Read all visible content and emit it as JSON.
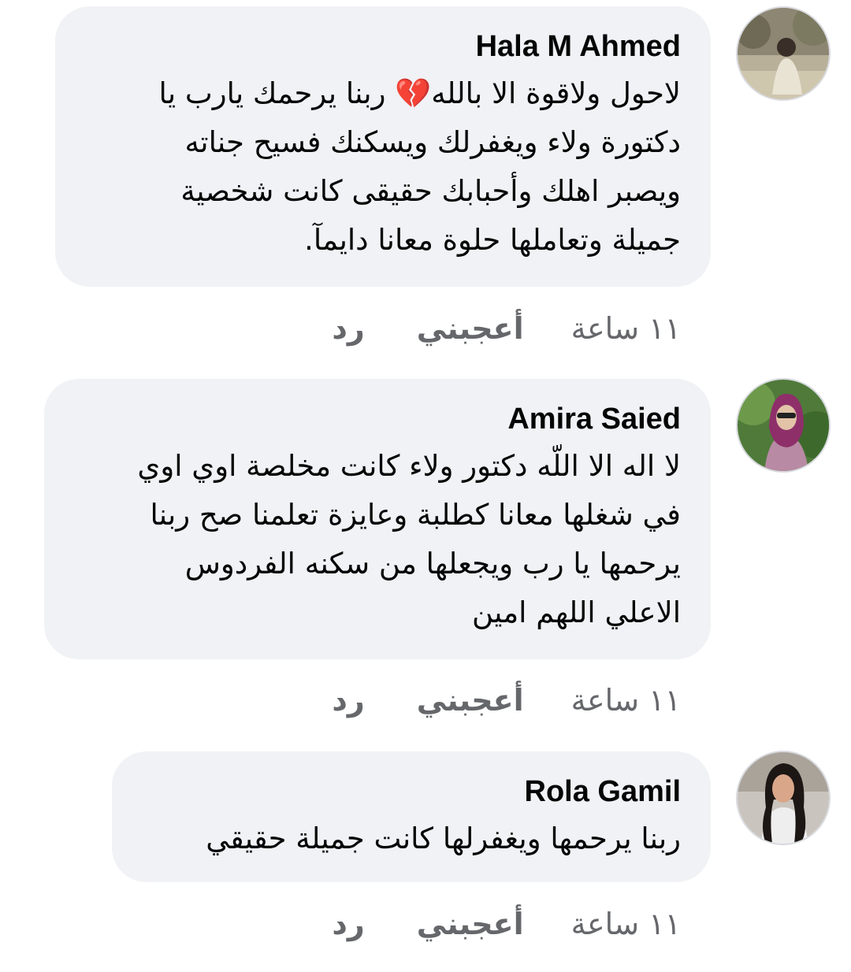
{
  "comments": [
    {
      "author": "Hala M Ahmed",
      "lines": [
        "لاحول ولاقوة الا بالله💔 ربنا يرحمك يارب يا",
        "دكتورة ولاء ويغفرلك ويسكنك فسيح جناته",
        "ويصبر اهلك وأحبابك حقيقى كانت  شخصية",
        "جميلة وتعاملها حلوة معانا دايمآ."
      ],
      "time": "١١ ساعة",
      "like_label": "أعجبني",
      "reply_label": "رد"
    },
    {
      "author": "Amira Saied",
      "lines": [
        "لا اله الا اللّه دكتور ولاء كانت مخلصة اوي اوي",
        "في شغلها معانا كطلبة وعايزة تعلمنا صح ربنا",
        "يرحمها يا رب ويجعلها من سكنه الفردوس",
        "الاعلي اللهم امين"
      ],
      "time": "١١ ساعة",
      "like_label": "أعجبني",
      "reply_label": "رد"
    },
    {
      "author": "Rola Gamil",
      "lines": [
        "ربنا يرحمها ويغفرلها كانت جميلة حقيقي"
      ],
      "time": "١١ ساعة",
      "like_label": "أعجبني",
      "reply_label": "رد"
    }
  ],
  "colors": {
    "bubble_bg": "#f0f2f5",
    "name": "#050505",
    "text": "#050505",
    "meta": "#65676b"
  }
}
